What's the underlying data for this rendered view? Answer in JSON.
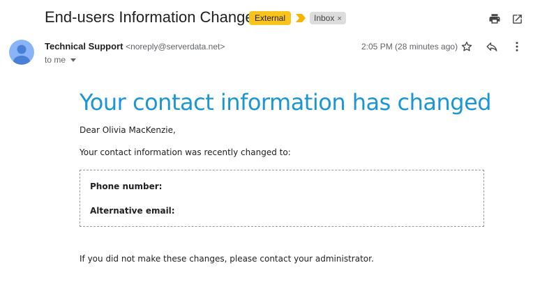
{
  "header": {
    "subject": "End-users Information Changed",
    "labels": {
      "external": "External",
      "inbox": "Inbox",
      "inbox_remove": "×"
    }
  },
  "message": {
    "sender_name": "Technical Support",
    "sender_email": "<noreply@serverdata.net>",
    "recipient": "to me",
    "timestamp": "2:05 PM (28 minutes ago)"
  },
  "content": {
    "heading": "Your contact information has changed",
    "greeting": "Dear Olivia MacKenzie,",
    "intro": "Your contact information was recently changed to:",
    "fields": [
      {
        "label": "Phone number:",
        "value": ""
      },
      {
        "label": "Alternative email:",
        "value": ""
      }
    ],
    "footer": "If you did not make these changes, please contact your administrator."
  },
  "icons": {
    "print": "print-icon",
    "open_new": "open-in-new-icon",
    "star": "star-icon",
    "reply": "reply-icon",
    "more": "more-vert-icon",
    "dropdown": "caret-down-icon",
    "importance": "importance-marker-icon",
    "avatar": "avatar-icon"
  },
  "colors": {
    "heading": "#1a96d6",
    "external_label": "#f9c31e",
    "importance_marker": "#f4b400",
    "inbox_label": "#dddddd",
    "avatar": "#8ab4f8"
  }
}
